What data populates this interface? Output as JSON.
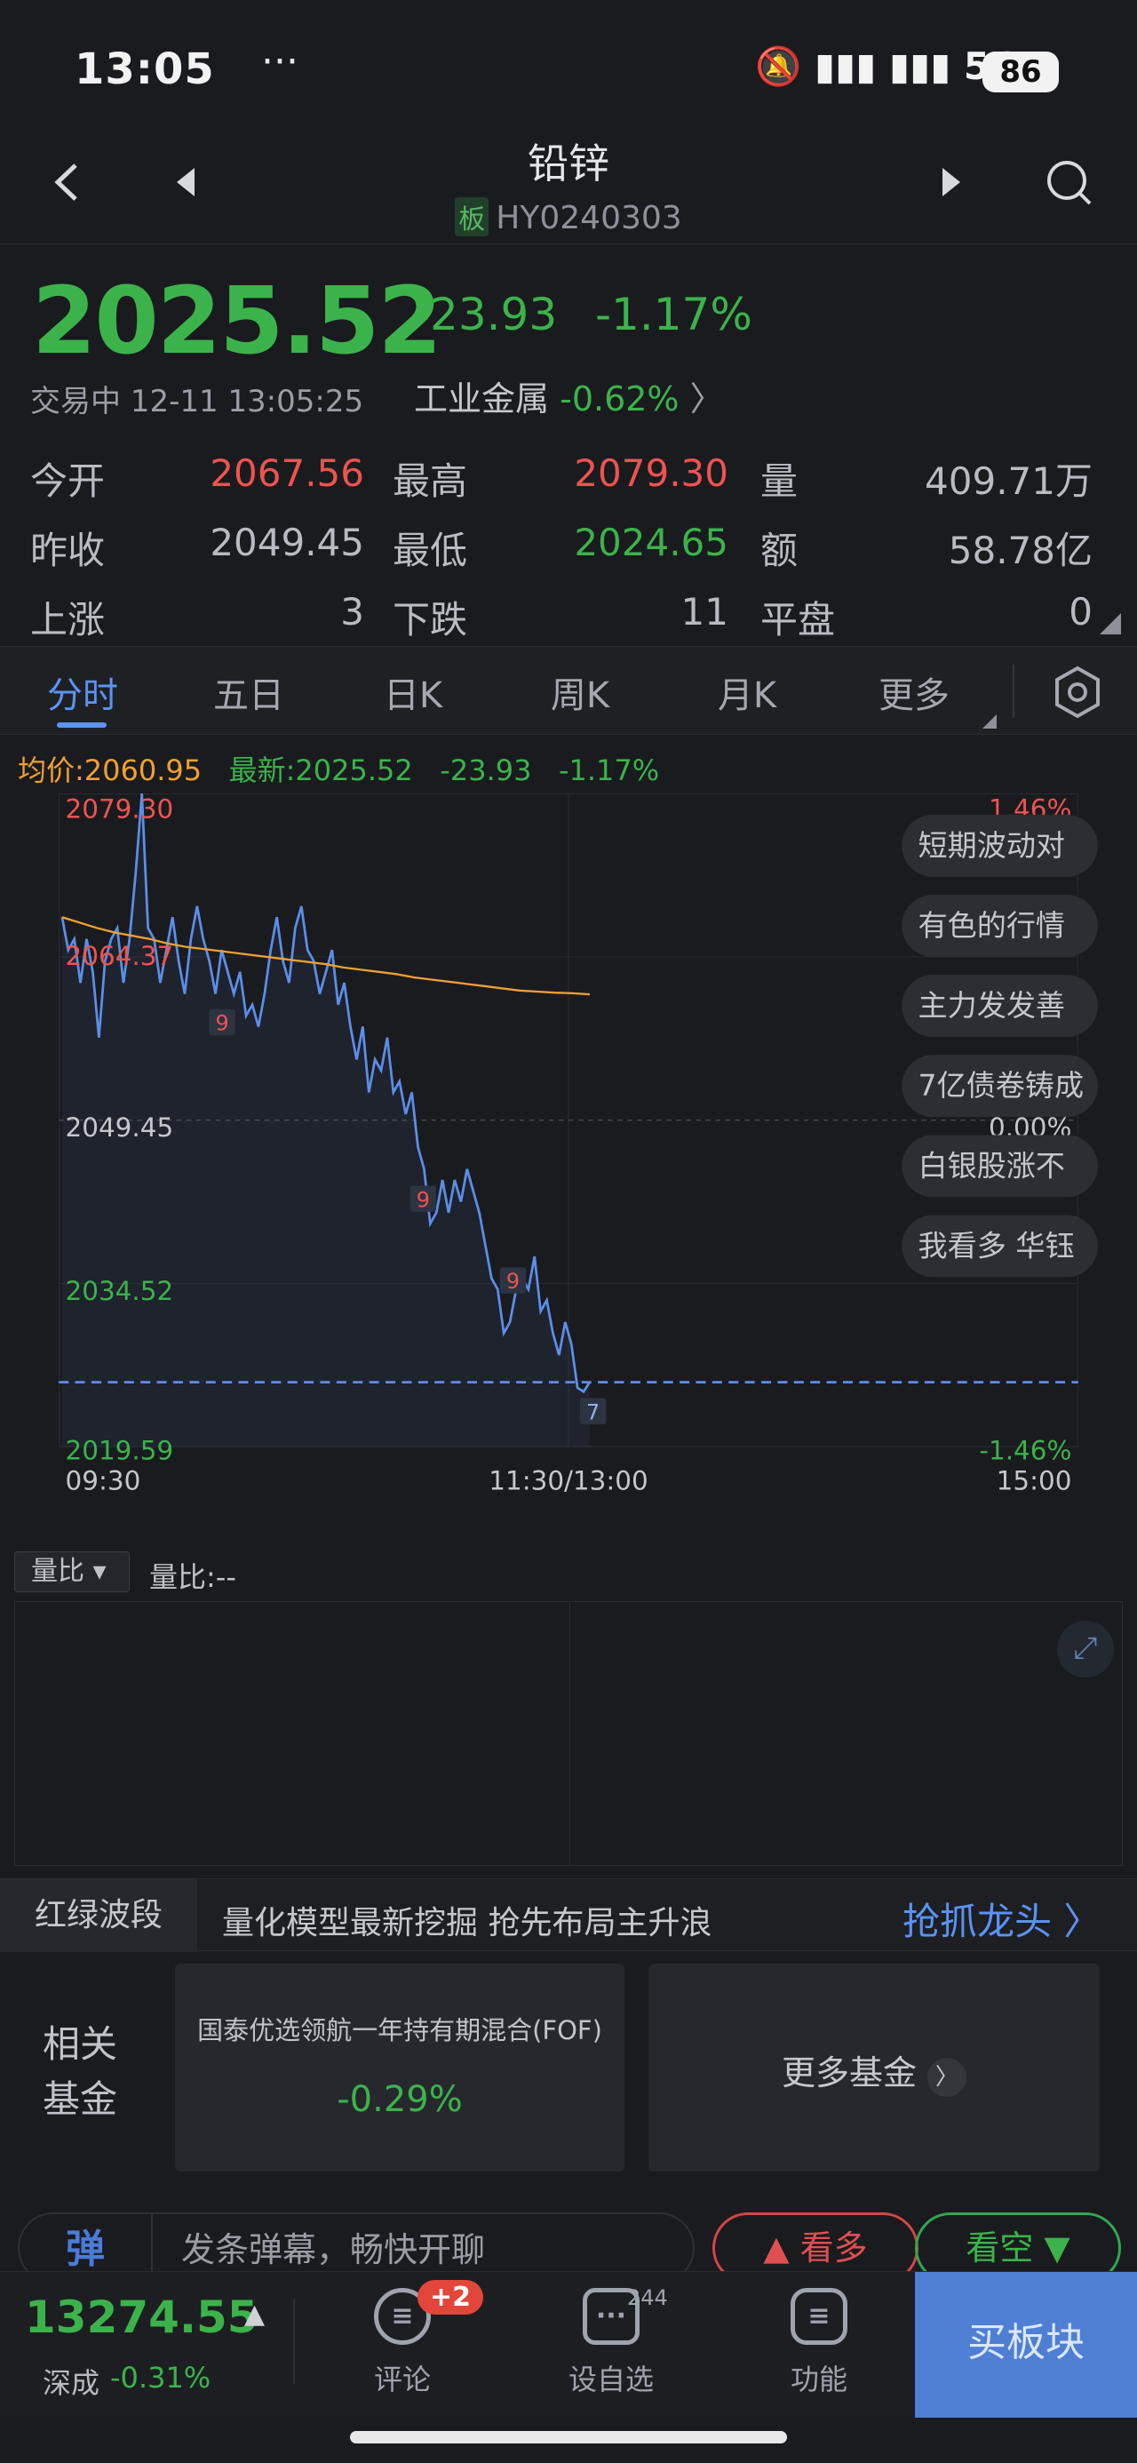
{
  "status_bar": {
    "time": "13:05",
    "dots": "···",
    "signal": "5G",
    "battery": "86"
  },
  "nav": {
    "title": "铅锌",
    "board_tag": "板",
    "code": "HY0240303"
  },
  "quote": {
    "price": "2025.52",
    "change": "-23.93",
    "change_pct": "-1.17%",
    "trading_status": "交易中 12-11 13:05:25",
    "sector_name": "工业金属",
    "sector_change": "-0.62%"
  },
  "stats": {
    "open_label": "今开",
    "open": "2067.56",
    "high_label": "最高",
    "high": "2079.30",
    "vol_label": "量",
    "vol": "409.71万",
    "prev_label": "昨收",
    "prev": "2049.45",
    "low_label": "最低",
    "low": "2024.65",
    "amount_label": "额",
    "amount": "58.78亿",
    "up_label": "上涨",
    "up": "3",
    "down_label": "下跌",
    "down": "11",
    "flat_label": "平盘",
    "flat": "0"
  },
  "tabs": [
    "分时",
    "五日",
    "日K",
    "周K",
    "月K",
    "更多"
  ],
  "legend": {
    "avg": "均价:2060.95",
    "latest": "最新:2025.52",
    "chg": "-23.93",
    "pct": "-1.17%"
  },
  "chart_data": {
    "type": "line",
    "title": "",
    "y_ticks_left": [
      "2079.30",
      "2064.37",
      "2049.45",
      "2034.52",
      "2019.59"
    ],
    "y_ticks_right": [
      "1.46%",
      "0.00%",
      "-1.46%"
    ],
    "x_ticks": [
      "09:30",
      "11:30/13:00",
      "15:00"
    ],
    "ylim": [
      2019.59,
      2079.3
    ],
    "prev_close": 2049.45,
    "series": [
      {
        "name": "最新",
        "values": [
          2068,
          2065,
          2066,
          2062,
          2066,
          2063,
          2057,
          2064,
          2066,
          2067,
          2062,
          2066,
          2072,
          2079.3,
          2067,
          2066,
          2062,
          2065,
          2068,
          2064,
          2061,
          2066,
          2069,
          2066,
          2064,
          2061,
          2065,
          2063,
          2061,
          2063,
          2059,
          2060,
          2058,
          2061,
          2065,
          2068,
          2064,
          2062,
          2067,
          2069,
          2065,
          2064,
          2061,
          2063,
          2065,
          2060,
          2062,
          2058,
          2055,
          2058,
          2052,
          2055,
          2054,
          2057,
          2052,
          2053,
          2050,
          2052,
          2047,
          2045,
          2040,
          2041,
          2044,
          2041,
          2044,
          2042,
          2045,
          2043,
          2041,
          2038,
          2035,
          2034,
          2030,
          2031,
          2034,
          2035,
          2034,
          2037,
          2032,
          2033,
          2030,
          2028,
          2031,
          2029,
          2025,
          2024.65,
          2025.52
        ]
      },
      {
        "name": "均价",
        "values": [
          2068,
          2067.5,
          2067,
          2066.6,
          2066.3,
          2066,
          2065.6,
          2065.3,
          2065.1,
          2064.9,
          2064.7,
          2064.5,
          2064.3,
          2064.1,
          2063.9,
          2063.7,
          2063.4,
          2063.2,
          2063,
          2062.8,
          2062.5,
          2062.3,
          2062.1,
          2061.9,
          2061.7,
          2061.5,
          2061.3,
          2061.2,
          2061.1,
          2061.05,
          2060.95
        ]
      }
    ],
    "markers": [
      "9",
      "9",
      "9",
      "7"
    ]
  },
  "news_bubbles": [
    "短期波动对",
    "有色的行情",
    "主力发发善",
    "7亿债卷铸成",
    "白银股涨不",
    "我看多 华钰"
  ],
  "volume": {
    "selector": "量比",
    "ratio": "量比:--"
  },
  "promo": {
    "tag": "红绿波段",
    "text": "量化模型最新挖掘 抢先布局主升浪",
    "link": "抢抓龙头"
  },
  "funds": {
    "label": "相关基金",
    "items": [
      {
        "name": "国泰优选领航一年持有期混合(FOF)",
        "change": "-0.29%"
      }
    ],
    "more": "更多基金"
  },
  "comment_bar": {
    "icon": "弹",
    "placeholder": "发条弹幕，畅快开聊",
    "bull": "看多",
    "bear": "看空"
  },
  "bottom_bar": {
    "index_value": "13274.55",
    "index_name": "深成",
    "index_change": "-0.31%",
    "comments": "评论",
    "comments_badge": "+2",
    "watchlist": "设自选",
    "watchlist_count": "244",
    "functions": "功能",
    "buy": "买板块"
  }
}
